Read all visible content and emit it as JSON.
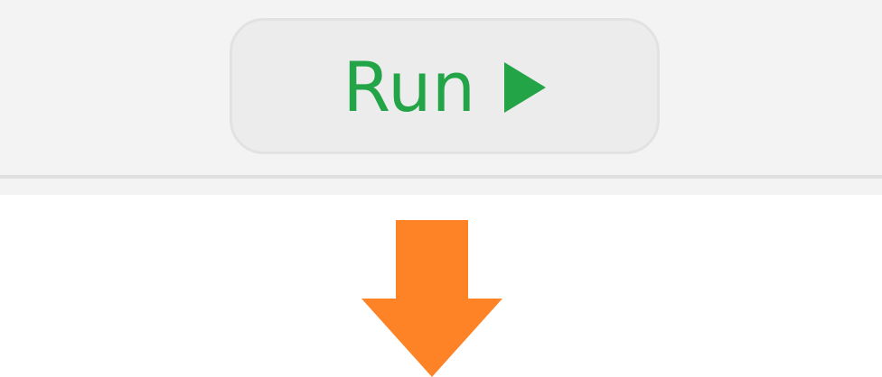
{
  "toolbar": {
    "run_button": {
      "label": "Run",
      "icon": "play-icon",
      "color": "#22a447"
    }
  },
  "indicator": {
    "icon": "arrow-down-icon",
    "color": "#fd8326"
  }
}
